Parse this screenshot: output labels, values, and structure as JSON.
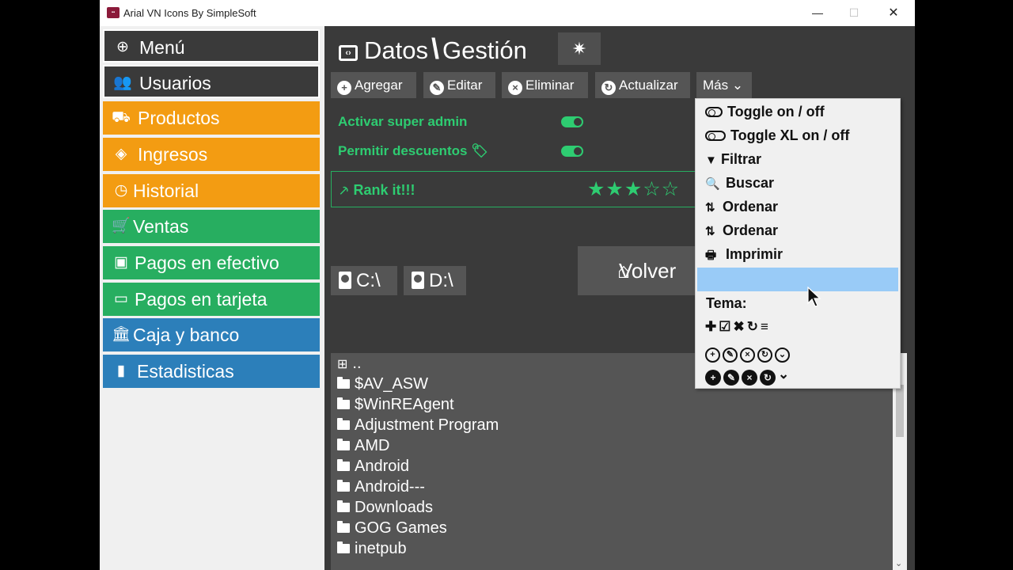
{
  "window": {
    "title": "Arial VN Icons By SimpleSoft",
    "minimize": "—",
    "maximize": "☐",
    "close": "✕"
  },
  "sidebar": {
    "items": [
      {
        "label": "Menú",
        "icon": "globe-icon",
        "glyph": "⊕",
        "color": "#3a3a3a"
      },
      {
        "label": "Usuarios",
        "icon": "users-icon",
        "glyph": "👥",
        "color": "#3a3a3a"
      },
      {
        "label": "Productos",
        "icon": "dolly-icon",
        "glyph": "⛟",
        "color": "#f39c12"
      },
      {
        "label": "Ingresos",
        "icon": "boxes-icon",
        "glyph": "◈",
        "color": "#f39c12"
      },
      {
        "label": "Historial",
        "icon": "clock-icon",
        "glyph": "◷",
        "color": "#f39c12"
      },
      {
        "label": "Ventas",
        "icon": "cart-icon",
        "glyph": "🛒",
        "color": "#27ae60"
      },
      {
        "label": "Pagos en efectivo",
        "icon": "money-icon",
        "glyph": "▣",
        "color": "#27ae60"
      },
      {
        "label": "Pagos en tarjeta",
        "icon": "credit-card-icon",
        "glyph": "▭",
        "color": "#27ae60"
      },
      {
        "label": "Caja y banco",
        "icon": "bank-icon",
        "glyph": "🏛",
        "color": "#2c7fba"
      },
      {
        "label": "Estadisticas",
        "icon": "bar-chart-icon",
        "glyph": "▮",
        "color": "#2c7fba"
      }
    ]
  },
  "header": {
    "title_left": "Datos",
    "title_sep": "\\",
    "title_right": "Gestión",
    "title_icon": "code-window-icon",
    "settings_icon": "gear-icon",
    "settings_glyph": "✷"
  },
  "toolbar": {
    "agregar": "Agregar",
    "editar": "Editar",
    "eliminar": "Eliminar",
    "actualizar": "Actualizar",
    "mas": "Más",
    "mas_chevron": "⌄"
  },
  "options": {
    "super_admin": "Activar super admin",
    "descuentos": "Permitir descuentos",
    "super_admin_on": true,
    "descuentos_on": true
  },
  "rank": {
    "label": "Rank it!!!",
    "stars": 3,
    "max_stars": 5,
    "filled": "★★★",
    "empty": "☆☆"
  },
  "drives": [
    {
      "label": "C:\\"
    },
    {
      "label": "D:\\"
    }
  ],
  "volver": {
    "label": "Volver"
  },
  "files": {
    "parent": "..",
    "items": [
      "$AV_ASW",
      "$WinREAgent",
      "Adjustment Program",
      "AMD",
      "Android",
      "Android---",
      "Downloads",
      "GOG Games",
      "inetpub"
    ]
  },
  "menu": {
    "items": [
      {
        "label": "Toggle on / off",
        "icon": "toggle-icon"
      },
      {
        "label": "Toggle XL on / off",
        "icon": "toggle-xl-icon"
      },
      {
        "label": "Filtrar",
        "icon": "filter-icon",
        "glyph": "▼"
      },
      {
        "label": "Buscar",
        "icon": "search-icon",
        "glyph": "🔍"
      },
      {
        "label": "Ordenar",
        "icon": "sort-asc-icon",
        "glyph": "⇅"
      },
      {
        "label": "Ordenar",
        "icon": "sort-desc-icon",
        "glyph": "⇅"
      },
      {
        "label": "Imprimir",
        "icon": "print-icon",
        "glyph": "🖶"
      }
    ],
    "tema_label": "Tema:",
    "accent": "#99cbf7"
  },
  "colors": {
    "green": "#2ecc71",
    "orange": "#f39c12",
    "blue": "#2c7fba",
    "dark": "#3a3a3a"
  }
}
